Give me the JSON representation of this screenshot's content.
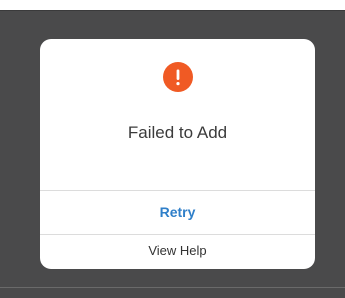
{
  "dialog": {
    "icon": "exclamation-alert-icon",
    "title": "Failed to Add",
    "retry_label": "Retry",
    "view_help_label": "View Help"
  },
  "colors": {
    "alert_icon": "#f05a24",
    "retry_text": "#2f7fc9",
    "backdrop": "#4a4a4b"
  }
}
